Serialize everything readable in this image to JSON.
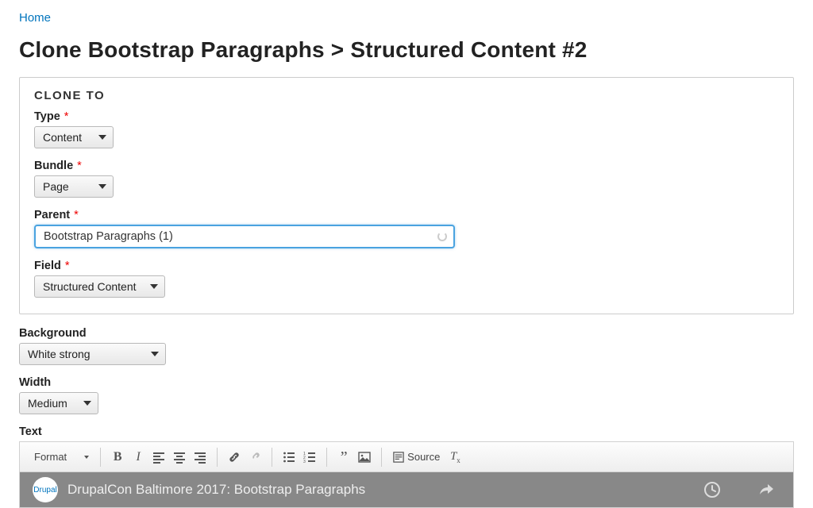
{
  "breadcrumb": {
    "home": "Home"
  },
  "page_title": "Clone Bootstrap Paragraphs > Structured Content #2",
  "clone_to": {
    "legend": "CLONE TO",
    "type": {
      "label": "Type",
      "value": "Content"
    },
    "bundle": {
      "label": "Bundle",
      "value": "Page"
    },
    "parent": {
      "label": "Parent",
      "value": "Bootstrap Paragraphs (1)"
    },
    "field": {
      "label": "Field",
      "value": "Structured Content"
    }
  },
  "background": {
    "label": "Background",
    "value": "White strong"
  },
  "width": {
    "label": "Width",
    "value": "Medium"
  },
  "text_label": "Text",
  "editor": {
    "format_label": "Format",
    "source_label": "Source"
  },
  "video": {
    "title": "DrupalCon Baltimore 2017: Bootstrap Paragraphs",
    "logo_text": "Drupal"
  }
}
